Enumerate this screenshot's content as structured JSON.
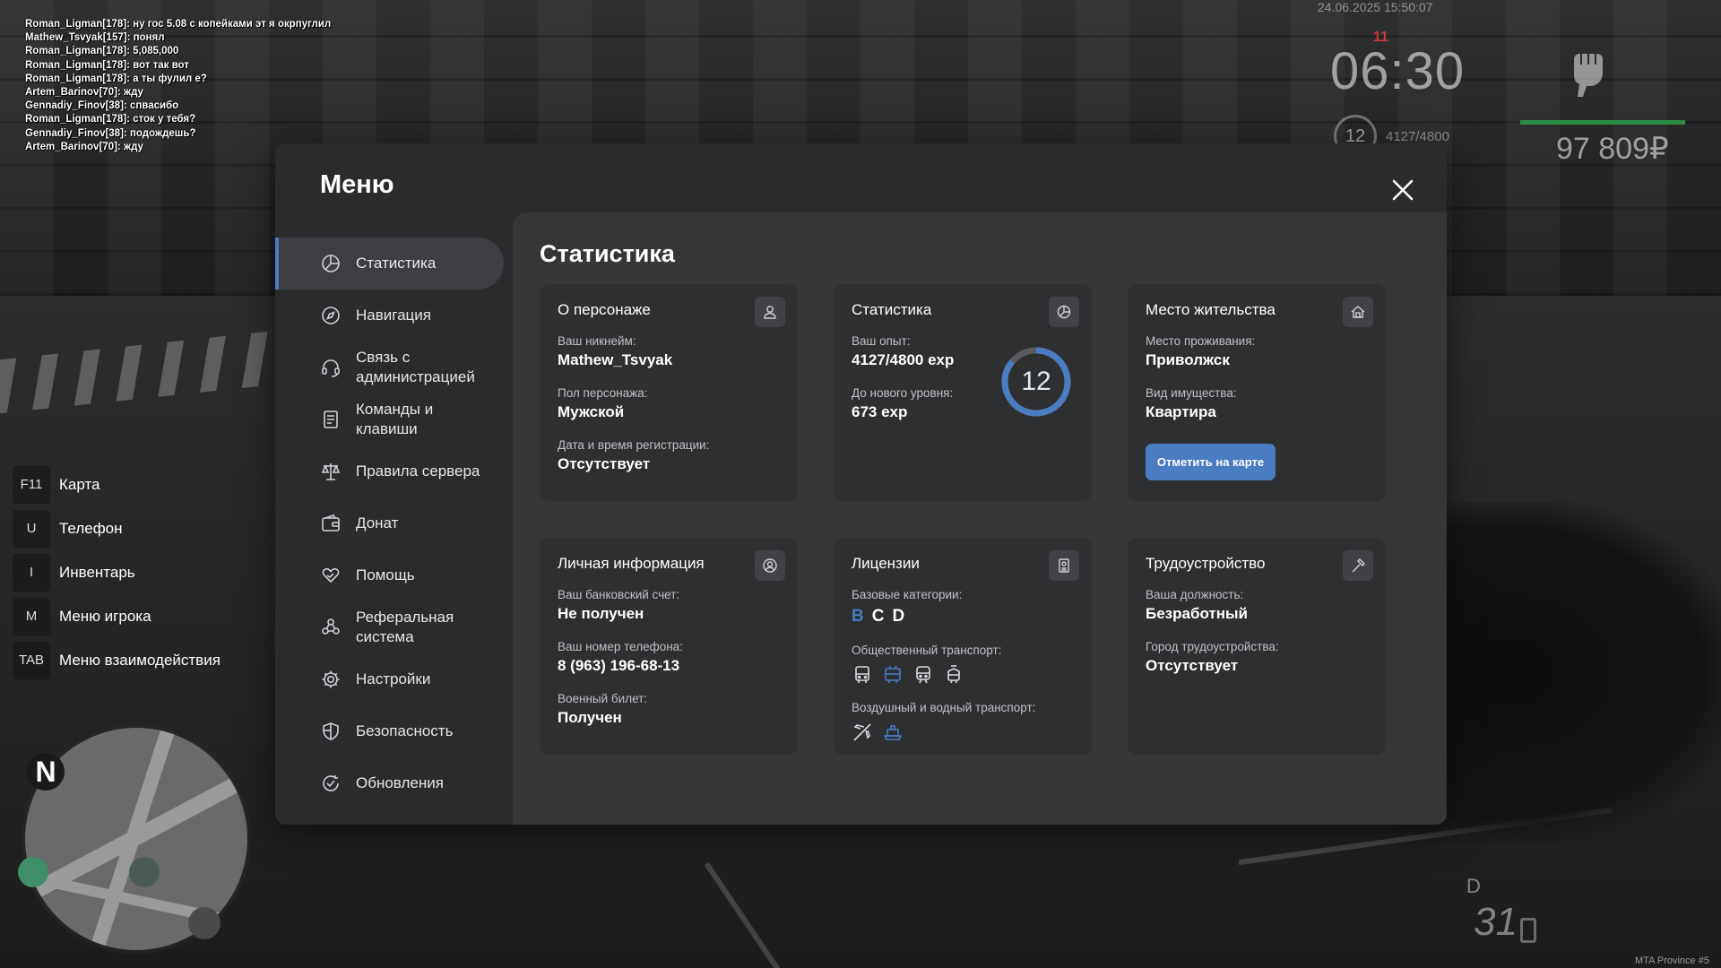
{
  "chat": [
    "Roman_Ligman[178]: ну гос 5.08 с копейками эт я окрпуглил",
    "Mathew_Tsvyak[157]: понял",
    "Roman_Ligman[178]: 5,085,000",
    "Roman_Ligman[178]: вот так вот",
    "Roman_Ligman[178]: а ты фулил е?",
    "Artem_Barinov[70]: жду",
    "Gennadiy_Finov[38]: спвасибо",
    "Roman_Ligman[178]: сток у тебя?",
    "Gennadiy_Finov[38]: подождешь?",
    "Artem_Barinov[70]: жду"
  ],
  "hud": {
    "datetime": "24.06.2025 15:50:07",
    "ping": "11",
    "time": "06:30",
    "level": "12",
    "exp": "4127/4800",
    "money": "97 809₽",
    "health_fraction": 1.0,
    "gear": "D",
    "speed": "31",
    "server": "MTA Province #5",
    "health_color": "#2f8a46"
  },
  "hotkeys": [
    {
      "key": "F11",
      "label": "Карта"
    },
    {
      "key": "U",
      "label": "Телефон"
    },
    {
      "key": "I",
      "label": "Инвентарь"
    },
    {
      "key": "M",
      "label": "Меню игрока"
    },
    {
      "key": "TAB",
      "label": "Меню взаимодействия"
    }
  ],
  "minimap": {
    "north": "N"
  },
  "menu": {
    "title": "Меню",
    "accent": "#4a7cc1",
    "sidebar": [
      {
        "label": "Статистика",
        "icon": "chart-pie-icon",
        "active": true
      },
      {
        "label": "Навигация",
        "icon": "compass-icon"
      },
      {
        "label": "Связь с администрацией",
        "icon": "headset-icon"
      },
      {
        "label": "Команды и клавиши",
        "icon": "document-list-icon"
      },
      {
        "label": "Правила сервера",
        "icon": "scales-icon"
      },
      {
        "label": "Донат",
        "icon": "wallet-icon"
      },
      {
        "label": "Помощь",
        "icon": "heart-hand-icon"
      },
      {
        "label": "Реферальная система",
        "icon": "people-icon"
      },
      {
        "label": "Настройки",
        "icon": "gear-icon"
      },
      {
        "label": "Безопасность",
        "icon": "shield-icon"
      },
      {
        "label": "Обновления",
        "icon": "refresh-check-icon"
      }
    ],
    "content_title": "Статистика",
    "cards": {
      "character": {
        "title": "О персонаже",
        "icon": "user-icon",
        "nickname_label": "Ваш никнейм:",
        "nickname": "Mathew_Tsvyak",
        "gender_label": "Пол персонажа:",
        "gender": "Мужской",
        "reg_label": "Дата и время регистрации:",
        "reg": "Отсутствует"
      },
      "stats": {
        "title": "Статистика",
        "icon": "chart-pie-icon",
        "exp_label": "Ваш опыт:",
        "exp": "4127/4800 exp",
        "next_label": "До нового уровня:",
        "next": "673 exp",
        "level": "12",
        "exp_current": 4127,
        "exp_max": 4800
      },
      "residence": {
        "title": "Место жительства",
        "icon": "house-icon",
        "place_label": "Место проживания:",
        "place": "Приволжск",
        "property_label": "Вид имущества:",
        "property": "Квартира",
        "button": "Отметить на карте"
      },
      "personal": {
        "title": "Личная информация",
        "icon": "user-circle-icon",
        "bank_label": "Ваш банковский счет:",
        "bank": "Не получен",
        "phone_label": "Ваш номер телефона:",
        "phone": "8 (963) 196-68-13",
        "military_label": "Военный билет:",
        "military": "Получен"
      },
      "licenses": {
        "title": "Лицензии",
        "icon": "id-badge-icon",
        "base_label": "Базовые категории:",
        "categories": [
          {
            "name": "B",
            "held": true
          },
          {
            "name": "C",
            "held": false
          },
          {
            "name": "D",
            "held": false
          }
        ],
        "public_label": "Общественный транспорт:",
        "public": [
          {
            "icon": "bus-icon",
            "held": false
          },
          {
            "icon": "trolleybus-icon",
            "held": true
          },
          {
            "icon": "train-icon",
            "held": false
          },
          {
            "icon": "tram-icon",
            "held": false
          }
        ],
        "air_label": "Воздушный и водный транспорт:",
        "air": [
          {
            "icon": "plane-icon",
            "held": false
          },
          {
            "icon": "ship-icon",
            "held": true
          }
        ]
      },
      "employment": {
        "title": "Трудоустройство",
        "icon": "hammer-icon",
        "position_label": "Ваша должность:",
        "position": "Безработный",
        "city_label": "Город трудоустройства:",
        "city": "Отсутствует"
      }
    }
  }
}
